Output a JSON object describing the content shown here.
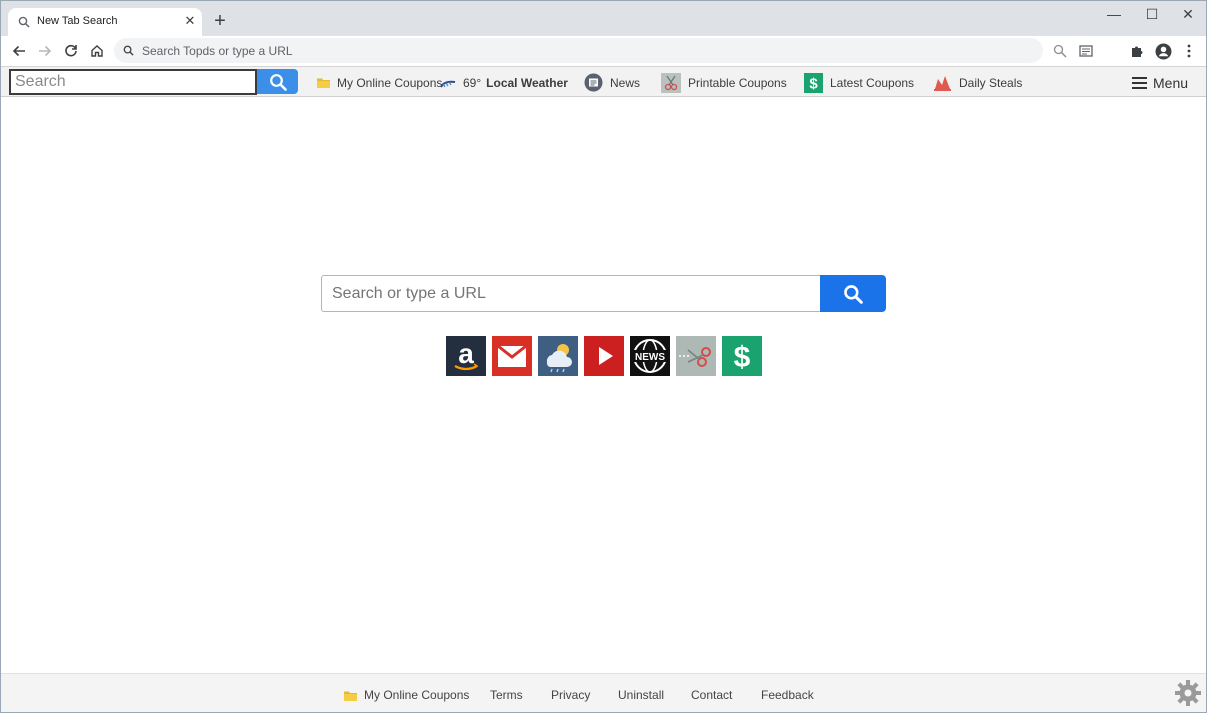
{
  "tab": {
    "title": "New Tab Search",
    "close": "✕",
    "new": "+"
  },
  "window_controls": {
    "minimize": "—",
    "maximize": "☐",
    "close": "✕"
  },
  "omnibox": {
    "placeholder": "Search Topds or type a URL"
  },
  "extension_bar": {
    "search_placeholder": "Search",
    "items": [
      {
        "label": "My Online Coupons"
      },
      {
        "temp": "69°",
        "label": "Local Weather"
      },
      {
        "label": "News"
      },
      {
        "label": "Printable Coupons"
      },
      {
        "label": "Latest Coupons"
      },
      {
        "label": "Daily Steals"
      }
    ],
    "menu_label": "Menu"
  },
  "main": {
    "search_placeholder": "Search or type a URL",
    "tiles": [
      {
        "name": "amazon-icon",
        "color": "#232f3e"
      },
      {
        "name": "gmail-icon",
        "color": "#d93025"
      },
      {
        "name": "weather-icon",
        "color": "#3f5f82"
      },
      {
        "name": "youtube-icon",
        "color": "#cc1f1f"
      },
      {
        "name": "news-icon",
        "color": "#111111"
      },
      {
        "name": "coupons-scissors-icon",
        "color": "#aeb8b4"
      },
      {
        "name": "dollar-icon",
        "color": "#1aa36e"
      }
    ],
    "tile_labels": {
      "amazon": "a",
      "dollar": "$",
      "news": "NEWS"
    }
  },
  "footer": {
    "links": [
      "My Online Coupons",
      "Terms",
      "Privacy",
      "Uninstall",
      "Contact",
      "Feedback"
    ]
  },
  "colors": {
    "accent": "#1a73e8",
    "ex_search_button": "#3b8fe8"
  }
}
